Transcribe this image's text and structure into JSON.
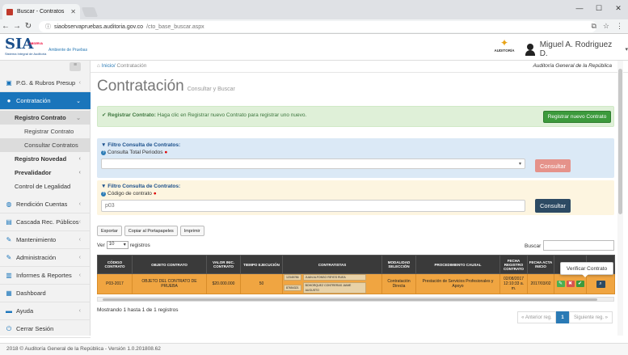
{
  "browser": {
    "tab_title": "Buscar - Contratos",
    "url_host": "siaobservapruebas.auditoria.gov.co",
    "url_path": "/cto_base_buscar.aspx"
  },
  "header": {
    "logo_text": "SIA",
    "logo_sub": "Sistema Integral de Auditoría",
    "logo_tag": "OBSERVA",
    "ambiente": "Ambiente de Pruebas",
    "auditoria_label": "AUDITORÍA",
    "user_name": "Miguel A. Rodriguez D.",
    "user_caret": "▾"
  },
  "sidebar": {
    "toggle": "≡",
    "items": [
      {
        "label": "P.G. & Rubros Presup",
        "icon": "cube-icon"
      },
      {
        "label": "Contratación",
        "icon": "circle-icon"
      },
      {
        "label": "Rendición Cuentas",
        "icon": "globe-icon"
      },
      {
        "label": "Cascada Rec. Públicos",
        "icon": "cascade-icon"
      },
      {
        "label": "Mantenimiento",
        "icon": "wrench-icon"
      },
      {
        "label": "Administración",
        "icon": "wrench-icon"
      },
      {
        "label": "Informes & Reportes",
        "icon": "report-icon"
      },
      {
        "label": "Dashboard",
        "icon": "dashboard-icon"
      },
      {
        "label": "Ayuda",
        "icon": "book-icon"
      },
      {
        "label": "Cerrar Sesión",
        "icon": "logout-icon"
      }
    ],
    "sub": {
      "registro_contrato": "Registro Contrato",
      "registrar_contrato": "Registrar Contrato",
      "consultar_contratos": "Consultar Contratos",
      "registro_novedad": "Registro Novedad",
      "prevalidador": "Prevalidador",
      "control_legalidad": "Control de Legalidad"
    }
  },
  "main": {
    "breadcrumb_home": "Inicio/",
    "breadcrumb_current": "Contratación",
    "org": "Auditoría General de la República",
    "title": "Contratación",
    "subtitle": "Consultar y Buscar",
    "alert_bold": "Registrar Contrato:",
    "alert_text": "Haga clic en Registrar nuevo Contrato para registrar uno nuevo.",
    "btn_new": "Registrar nuevo Contrato",
    "filter1_title": "Filtro Consulta de Contratos:",
    "filter1_label": "Consulta Total Periodos",
    "btn_consultar": "Consultar",
    "filter2_title": "Filtro Consulta de Contratos:",
    "filter2_label": "Código de contrato",
    "filter2_value": "p03",
    "toolbar": [
      "Exportar",
      "Copiar al Portapapeles",
      "Imprimir"
    ],
    "ver_label": "Ver",
    "ver_value": "10",
    "registros_label": "registros",
    "search_label": "Buscar",
    "tooltip": "Verificar Contrato",
    "showing": "Mostrando 1 hasta 1 de 1 registros",
    "pager": {
      "prev": "« Anterior reg.",
      "page": "1",
      "next": "Siguiente reg. »"
    }
  },
  "table": {
    "headers": [
      "CÓDIGO CONTRATO",
      "OBJETO CONTRATO",
      "VALOR INIC. CONTRATO",
      "TIEMPO EJECUCIÓN",
      "CONTRATISTAS",
      "MODALIDAD SELECCIÓN",
      "PROCEDIMIENTO CAUSAL",
      "FECHA REGISTRO CONTRATO",
      "FECHA ACTA INICIO",
      "",
      ""
    ],
    "row": {
      "codigo": "P03-2017",
      "objeto": "OBJETO DEL CONTRATO DE PRUEBA",
      "valor": "$20.000.000",
      "tiempo": "50",
      "contratista1_id": "12345786",
      "contratista1_nm": "JUAN ALFONSO REYES RUEA",
      "contratista2_id": "87654321",
      "contratista2_nm": "BOHORQUEZ CONTRERAS JAIME AUGUSTO",
      "modalidad": "Contratación Directa",
      "procedimiento": "Prestación de Servicios Profesionales y Apoyo",
      "fecha_registro": "02/08/2017 12:10:33 a. m.",
      "fecha_acta": "2017/03/02"
    }
  },
  "footer": {
    "text": "2018 © Auditoría General de la República - Versión 1.0.201808.62"
  },
  "colors": {
    "primary": "#1a75bb",
    "success": "#3c9a3c",
    "row_orange": "#f0a541",
    "dark_button": "#2d4a63"
  }
}
